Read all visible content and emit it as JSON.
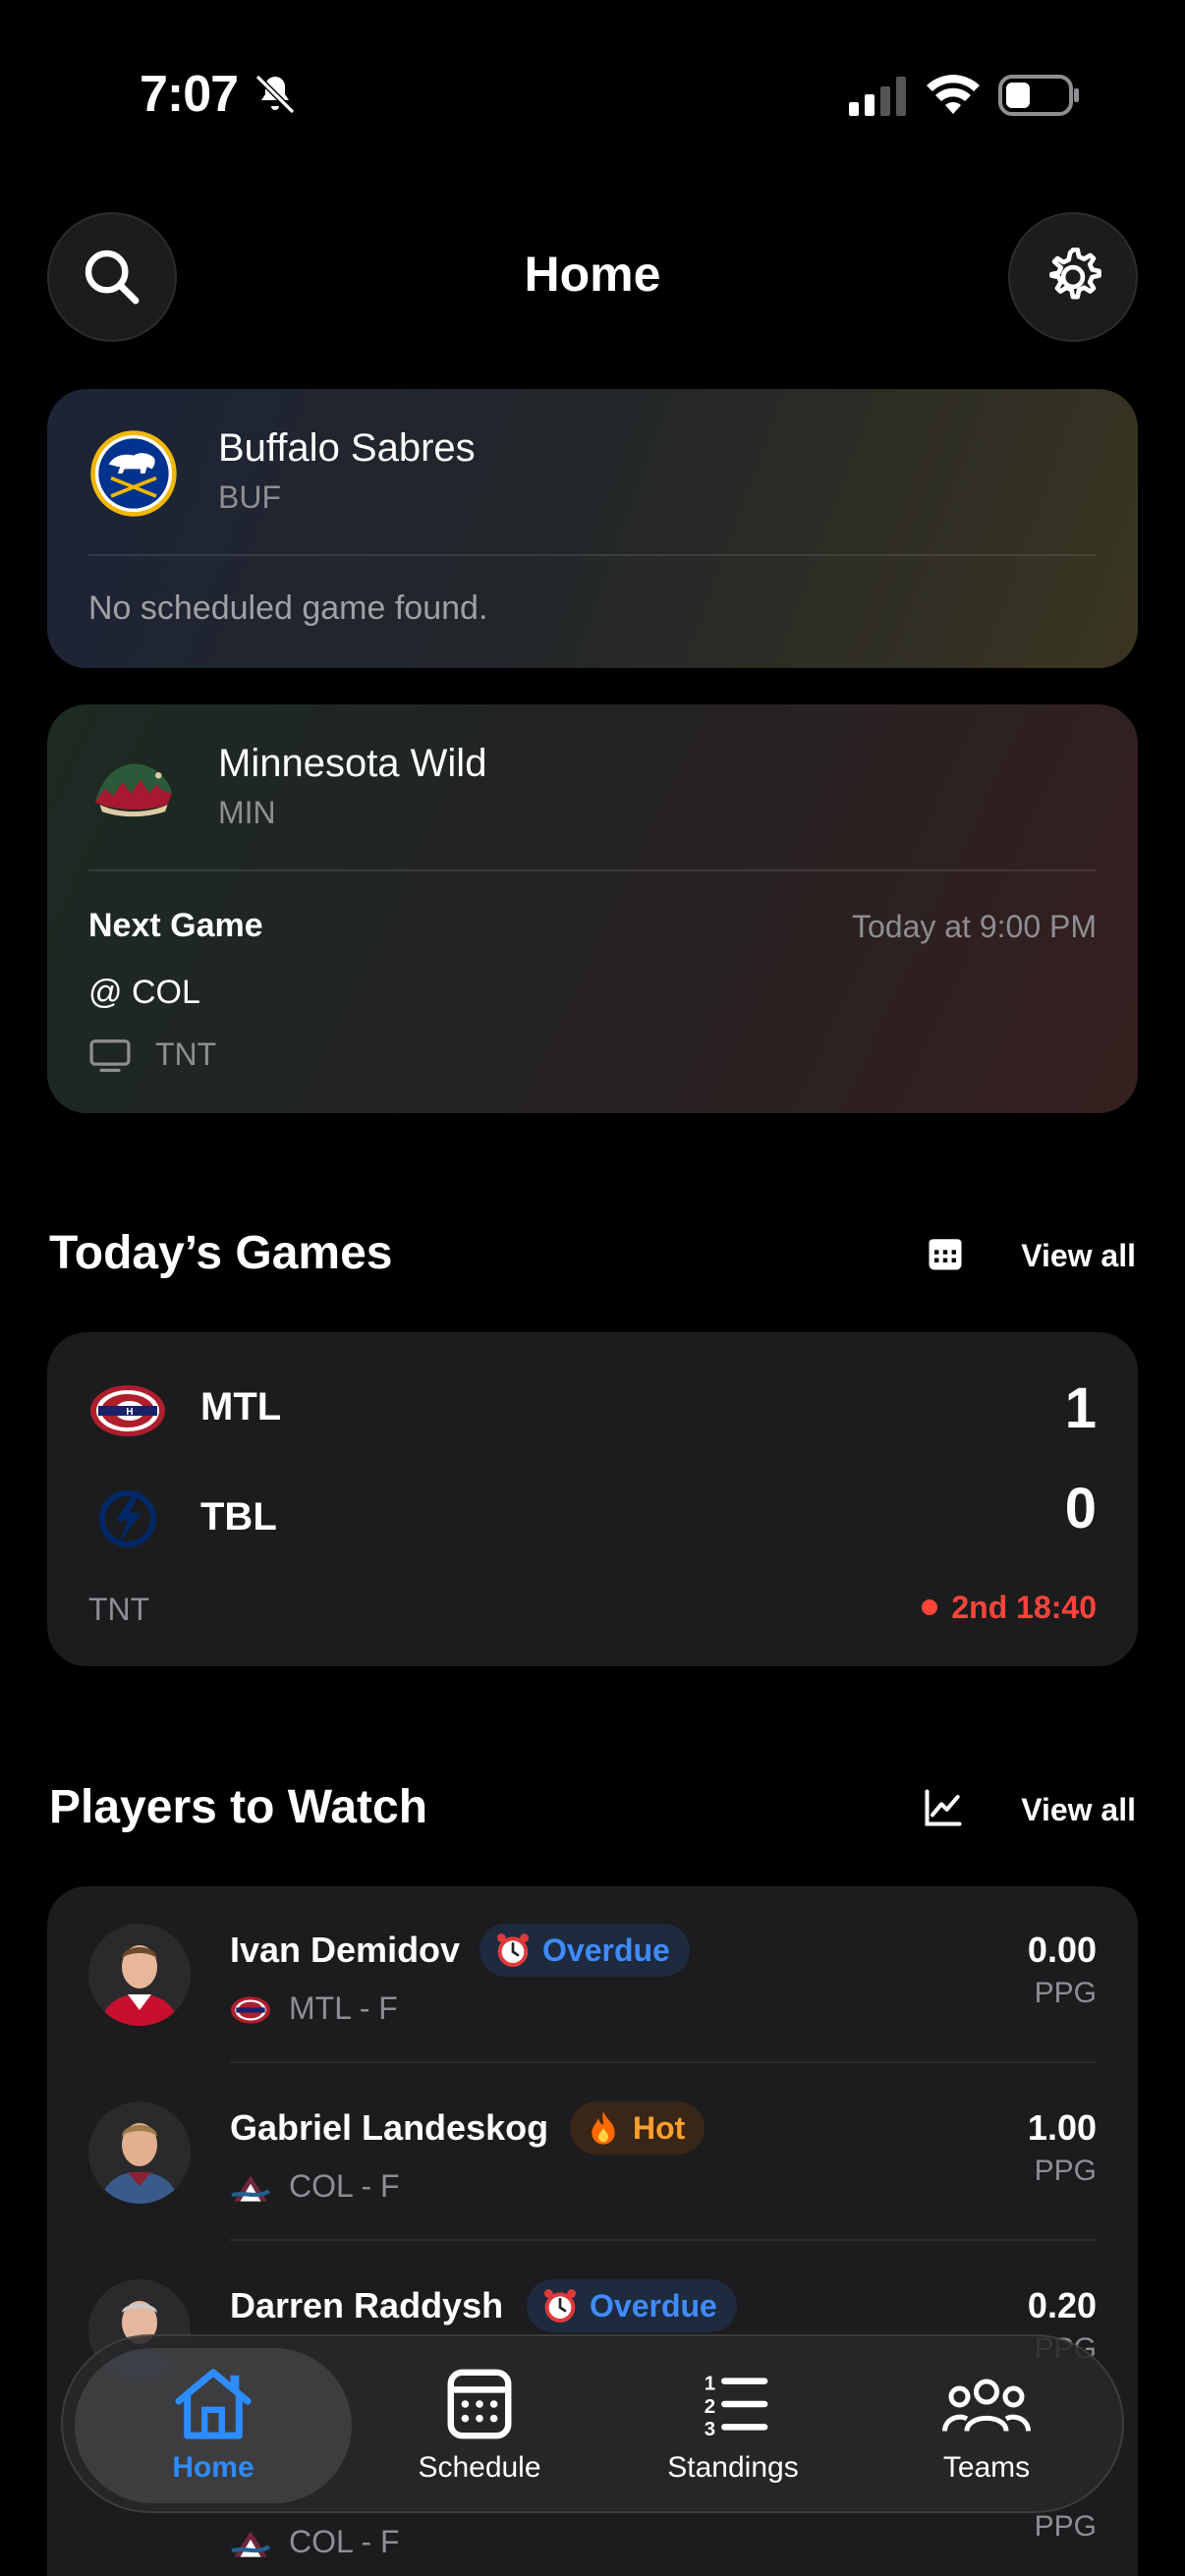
{
  "status_bar": {
    "time": "7:07"
  },
  "header": {
    "title": "Home"
  },
  "favorite_teams": [
    {
      "name": "Buffalo Sabres",
      "abbr": "BUF",
      "message": "No scheduled game found."
    },
    {
      "name": "Minnesota Wild",
      "abbr": "MIN",
      "next_game_label": "Next Game",
      "next_game_time": "Today at 9:00 PM",
      "opponent": "@ COL",
      "network": "TNT"
    }
  ],
  "todays_games": {
    "title": "Today’s Games",
    "view_all": "View all",
    "games": [
      {
        "home": "MTL",
        "home_score": "1",
        "away": "TBL",
        "away_score": "0",
        "network": "TNT",
        "status": "2nd 18:40"
      }
    ]
  },
  "players_to_watch": {
    "title": "Players to Watch",
    "view_all": "View all",
    "players": [
      {
        "name": "Ivan Demidov",
        "badge": "Overdue",
        "meta": "MTL - F",
        "ppg": "0.00",
        "ppg_label": "PPG"
      },
      {
        "name": "Gabriel Landeskog",
        "badge": "Hot",
        "meta": "COL - F",
        "ppg": "1.00",
        "ppg_label": "PPG"
      },
      {
        "name": "Darren Raddysh",
        "badge": "Overdue",
        "meta": "",
        "ppg": "0.20",
        "ppg_label": "PPG"
      },
      {
        "name": "",
        "badge": "",
        "meta": "COL - F",
        "ppg": "",
        "ppg_label": "PPG"
      }
    ]
  },
  "tab_bar": {
    "tabs": [
      {
        "label": "Home",
        "active": true
      },
      {
        "label": "Schedule"
      },
      {
        "label": "Standings"
      },
      {
        "label": "Teams"
      }
    ]
  },
  "colors": {
    "accent": "#2d8cff",
    "live": "#ff453a",
    "hot": "#ff9f2e",
    "overdue": "#3f8bff"
  }
}
